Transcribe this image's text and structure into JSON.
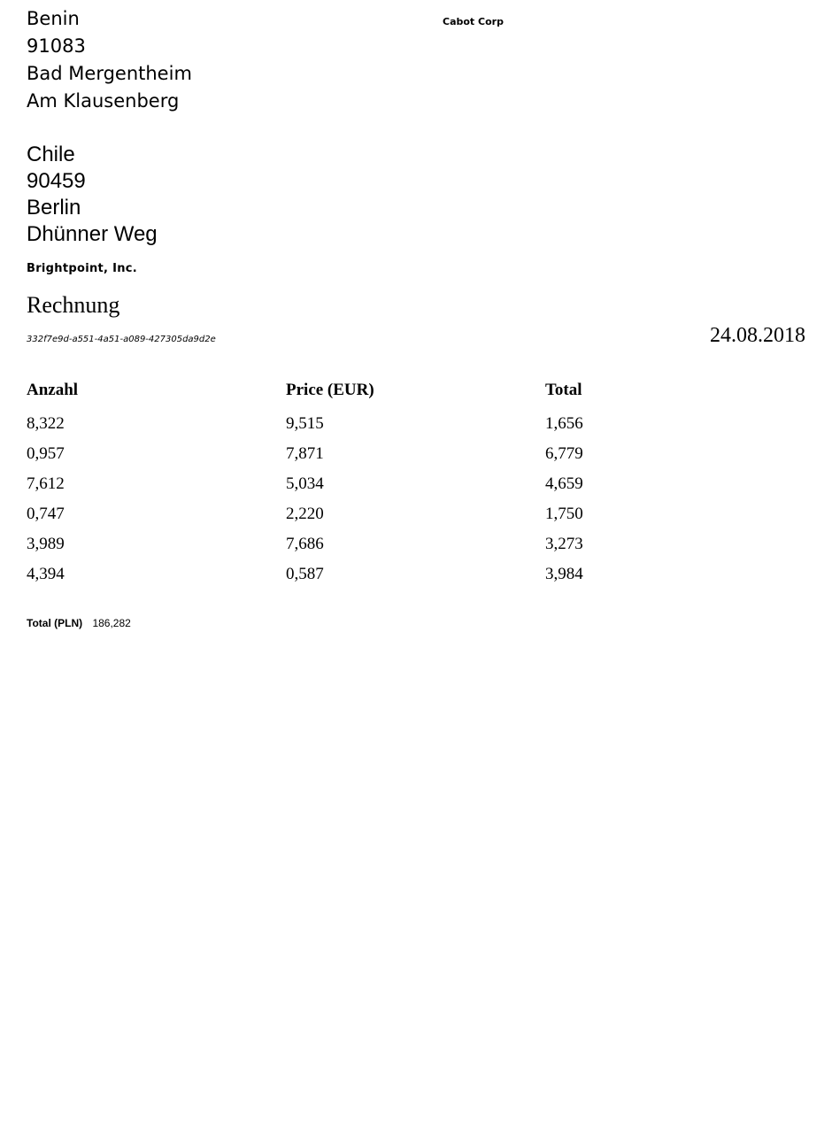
{
  "sender": {
    "address_lines": [
      "Benin",
      "91083",
      "Bad Mergentheim",
      "Am Klausenberg"
    ],
    "company": "Cabot Corp"
  },
  "recipient": {
    "address_lines": [
      "Chile",
      "90459",
      "Berlin",
      "Dhünner Weg"
    ],
    "company": "Brightpoint, Inc."
  },
  "document": {
    "title": "Rechnung",
    "id": "332f7e9d-a551-4a51-a089-427305da9d2e",
    "date": "24.08.2018"
  },
  "table": {
    "headers": {
      "quantity": "Anzahl",
      "price": "Price (EUR)",
      "total": "Total"
    },
    "rows": [
      {
        "quantity": "8,322",
        "price": "9,515",
        "total": "1,656"
      },
      {
        "quantity": "0,957",
        "price": "7,871",
        "total": "6,779"
      },
      {
        "quantity": "7,612",
        "price": "5,034",
        "total": "4,659"
      },
      {
        "quantity": "0,747",
        "price": "2,220",
        "total": "1,750"
      },
      {
        "quantity": "3,989",
        "price": "7,686",
        "total": "3,273"
      },
      {
        "quantity": "4,394",
        "price": "0,587",
        "total": "3,984"
      }
    ]
  },
  "summary": {
    "total_label": "Total (PLN)",
    "total_value": "186,282"
  }
}
